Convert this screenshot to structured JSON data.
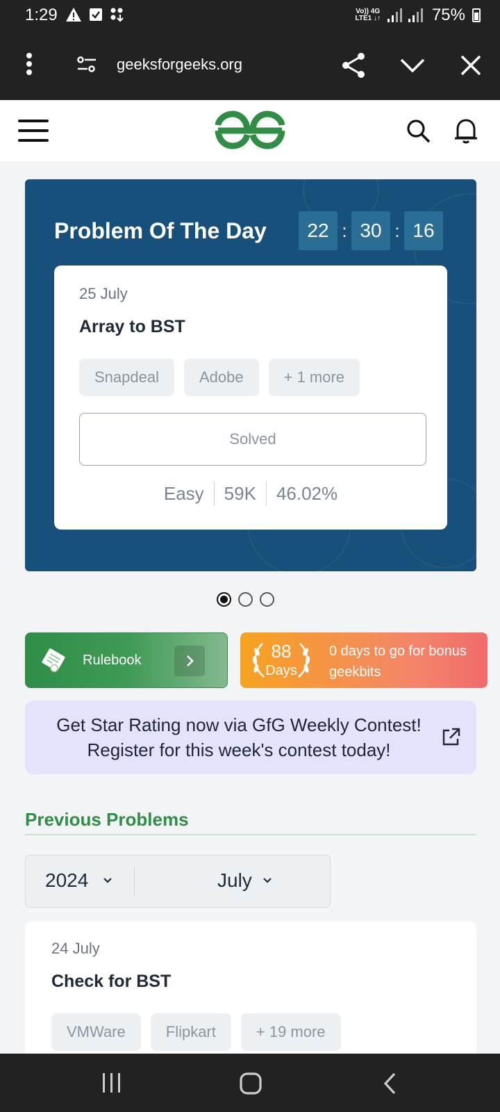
{
  "status_bar": {
    "time": "1:29",
    "network_top": "Vo)) 4G",
    "network_bottom": "LTE1 ↓↑",
    "battery": "75%"
  },
  "browser": {
    "url": "geeksforgeeks.org"
  },
  "potd": {
    "title": "Problem Of The Day",
    "timer": {
      "hours": "22",
      "minutes": "30",
      "seconds": "16",
      "separator": ":"
    },
    "date": "25 July",
    "problem": "Array to BST",
    "tags": [
      "Snapdeal",
      "Adobe",
      "+ 1 more"
    ],
    "status_button": "Solved",
    "difficulty": "Easy",
    "submissions": "59K",
    "accuracy": "46.02%"
  },
  "carousel": {
    "count": 3,
    "active_index": 0
  },
  "rulebook": {
    "label": "Rulebook"
  },
  "streak": {
    "number": "88",
    "unit": "Days",
    "bonus_text": "0 days to go for bonus geekbits"
  },
  "contest_banner": {
    "line1": "Get Star Rating now via GfG Weekly Contest!",
    "line2": "Register for this week's contest today!"
  },
  "previous": {
    "heading": "Previous Problems",
    "year": "2024",
    "month": "July",
    "card": {
      "date": "24 July",
      "problem": "Check for BST",
      "tags": [
        "VMWare",
        "Flipkart",
        "+ 19 more"
      ]
    }
  },
  "colors": {
    "brand_green": "#2f8d46",
    "potd_blue": "#17507a",
    "contest_bg": "#e5e2fb"
  },
  "icons": [
    "warning-icon",
    "checkbox-icon",
    "download-icon",
    "signal-icon",
    "battery-icon",
    "kebab-menu-icon",
    "tune-icon",
    "share-icon",
    "chevron-down-icon",
    "close-icon",
    "hamburger-icon",
    "gfg-logo",
    "search-icon",
    "bell-icon",
    "certificate-icon",
    "chevron-right-icon",
    "laurel-icon",
    "external-link-icon",
    "recent-apps-icon",
    "home-icon",
    "back-icon"
  ]
}
